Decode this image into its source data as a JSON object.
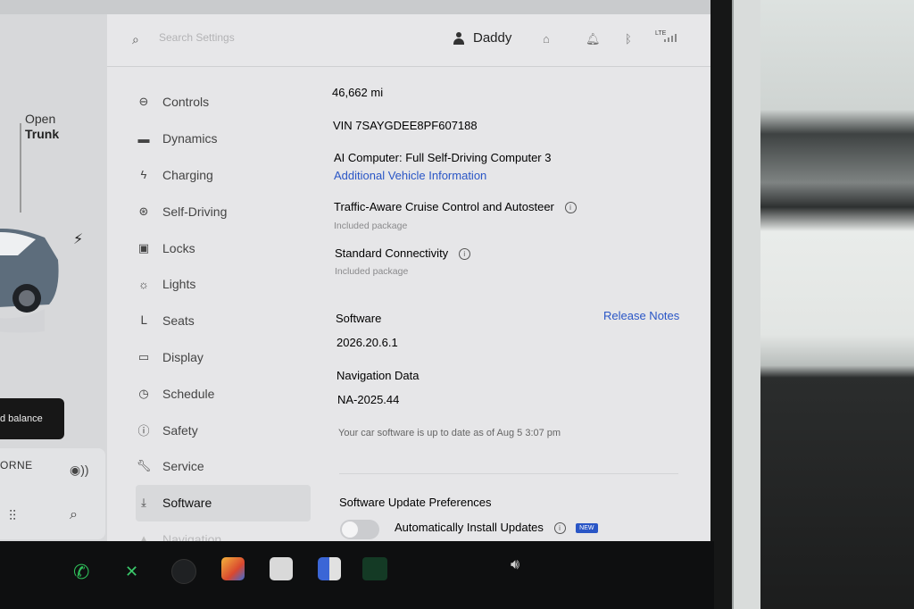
{
  "header": {
    "search_placeholder": "Search Settings",
    "user_name": "Daddy",
    "lte_label": "LTE"
  },
  "car_panel": {
    "trunk_state": "Open",
    "trunk_label": "Trunk",
    "toast_text": "d balance",
    "media_label": "ORNE"
  },
  "sidebar": {
    "items": [
      {
        "label": "Controls",
        "icon": "toggle-icon"
      },
      {
        "label": "Dynamics",
        "icon": "car-icon"
      },
      {
        "label": "Charging",
        "icon": "bolt-icon"
      },
      {
        "label": "Self-Driving",
        "icon": "steering-wheel-icon"
      },
      {
        "label": "Locks",
        "icon": "lock-icon"
      },
      {
        "label": "Lights",
        "icon": "light-icon"
      },
      {
        "label": "Seats",
        "icon": "seat-icon"
      },
      {
        "label": "Display",
        "icon": "display-icon"
      },
      {
        "label": "Schedule",
        "icon": "clock-icon"
      },
      {
        "label": "Safety",
        "icon": "safety-icon"
      },
      {
        "label": "Service",
        "icon": "wrench-icon"
      },
      {
        "label": "Software",
        "icon": "download-icon",
        "active": true
      },
      {
        "label": "Navigation",
        "icon": "navigation-icon"
      }
    ]
  },
  "content": {
    "odometer": "46,662 mi",
    "vin": "VIN 7SAYGDEE8PF607188",
    "ai_computer": "AI Computer: Full Self-Driving Computer 3",
    "additional_info_link": "Additional Vehicle Information",
    "tacc": {
      "label": "Traffic-Aware Cruise Control and Autosteer",
      "sub": "Included package"
    },
    "connectivity": {
      "label": "Standard Connectivity",
      "sub": "Included package"
    },
    "software_label": "Software",
    "release_notes_link": "Release Notes",
    "software_version": "2026.20.6.1",
    "navigation_label": "Navigation Data",
    "navigation_version": "NA-2025.44",
    "update_status": "Your car software is up to date as of Aug 5 3:07 pm",
    "update_prefs_label": "Software Update Preferences",
    "auto_install_label": "Automatically Install Updates",
    "auto_install_enabled": false,
    "new_badge": "NEW"
  },
  "colors": {
    "link": "#2a56c6",
    "screen_bg": "#e6e6e8",
    "active_bg": "#d8d9db"
  }
}
